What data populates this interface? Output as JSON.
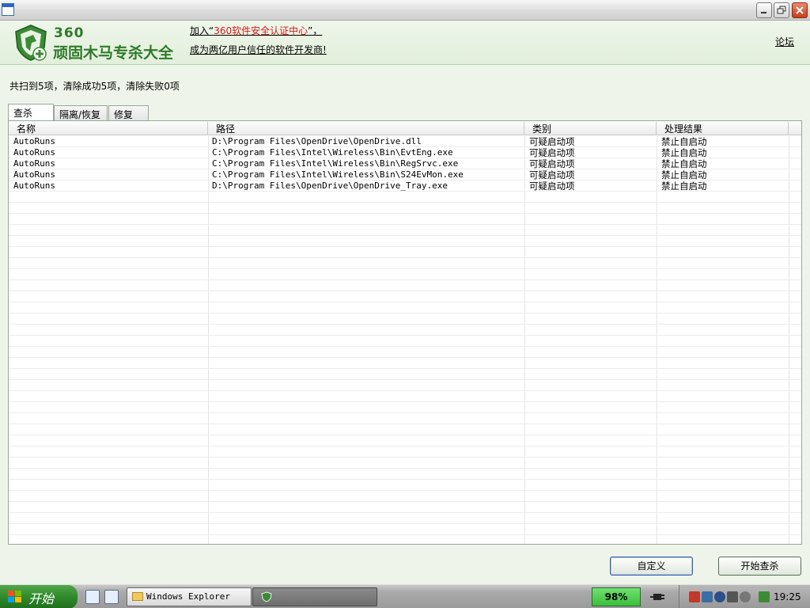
{
  "window": {
    "title": ""
  },
  "header": {
    "logo_number": "360",
    "logo_title": "顽固木马专杀大全",
    "promo_line1_prefix": "加入“",
    "promo_line1_link": "360软件安全认证中心",
    "promo_line1_suffix": "”，",
    "promo_line2": "成为两亿用户信任的软件开发商!",
    "forum_label": "论坛"
  },
  "summary": "共扫到5项，清除成功5项，清除失败0项",
  "tabs": [
    {
      "label": "查杀",
      "active": true
    },
    {
      "label": "隔离/恢复",
      "active": false
    },
    {
      "label": "修复",
      "active": false
    }
  ],
  "table": {
    "columns": [
      "名称",
      "路径",
      "类别",
      "处理结果"
    ],
    "rows": [
      {
        "name": "AutoRuns",
        "path": "D:\\Program Files\\OpenDrive\\OpenDrive.dll",
        "category": "可疑启动项",
        "result": "禁止自启动"
      },
      {
        "name": "AutoRuns",
        "path": "C:\\Program Files\\Intel\\Wireless\\Bin\\EvtEng.exe",
        "category": "可疑启动项",
        "result": "禁止自启动"
      },
      {
        "name": "AutoRuns",
        "path": "C:\\Program Files\\Intel\\Wireless\\Bin\\RegSrvc.exe",
        "category": "可疑启动项",
        "result": "禁止自启动"
      },
      {
        "name": "AutoRuns",
        "path": "C:\\Program Files\\Intel\\Wireless\\Bin\\S24EvMon.exe",
        "category": "可疑启动项",
        "result": "禁止自启动"
      },
      {
        "name": "AutoRuns",
        "path": "D:\\Program Files\\OpenDrive\\OpenDrive_Tray.exe",
        "category": "可疑启动项",
        "result": "禁止自启动"
      }
    ]
  },
  "buttons": {
    "custom": "自定义",
    "scan": "开始查杀"
  },
  "taskbar": {
    "start_label": "开始",
    "explorer_task": "Windows Explorer",
    "battery": "98%",
    "clock": "19:25"
  },
  "colors": {
    "brand_green": "#2f7a2a",
    "link_red": "#d21b1b",
    "header_bg": "#e2efdb"
  }
}
